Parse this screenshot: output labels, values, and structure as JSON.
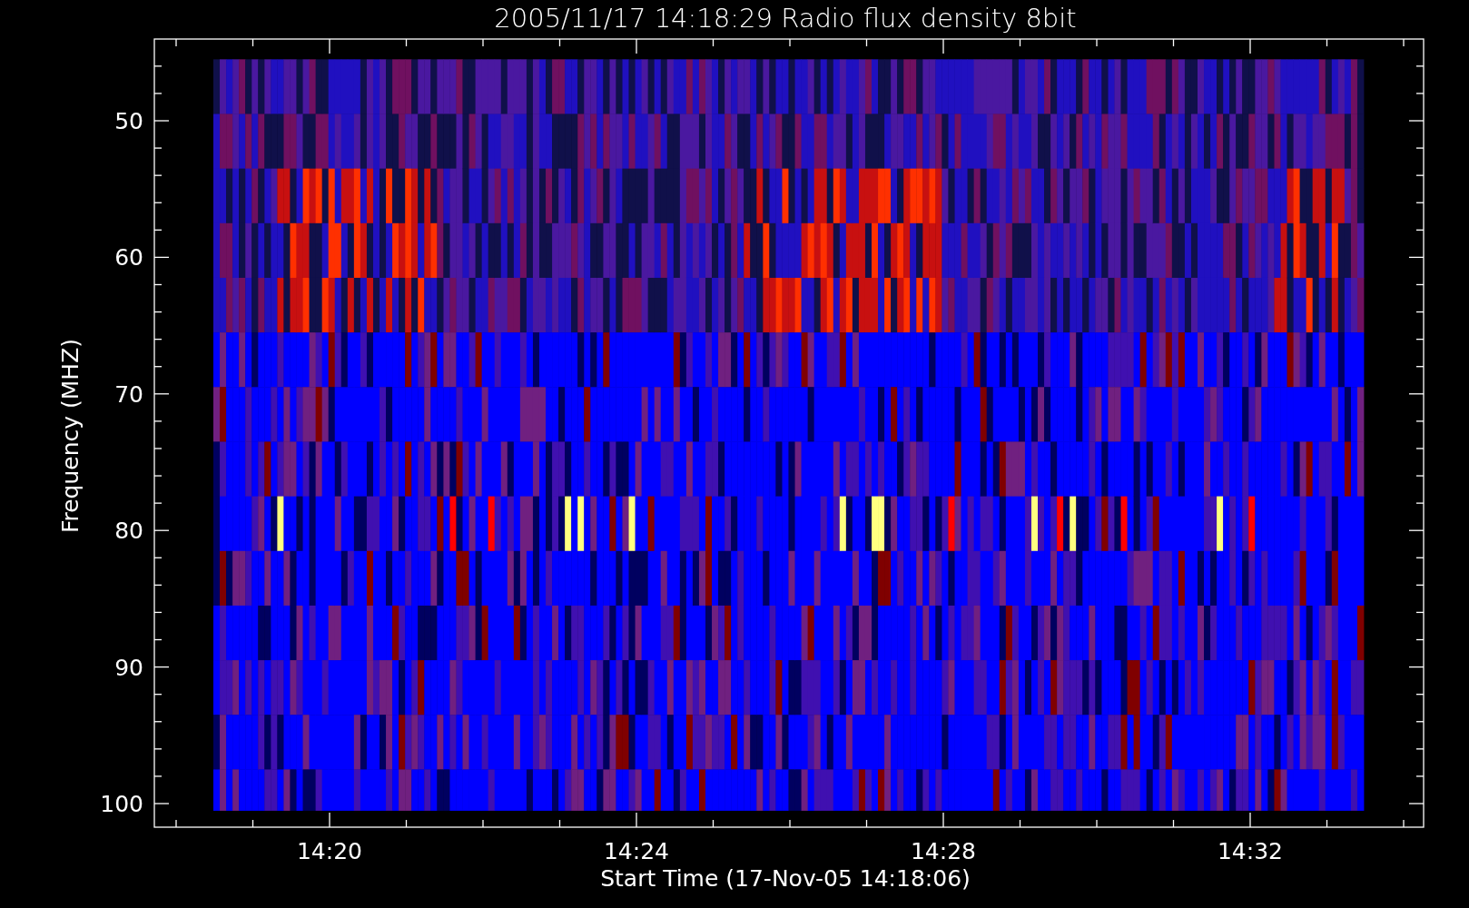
{
  "plot": {
    "title": "2005/11/17 14:18:29 Radio flux density 8bit",
    "xlabel": "Start Time (17-Nov-05 14:18:06)",
    "ylabel": "Frequency (MHZ)",
    "yticks": [
      "50",
      "60",
      "70",
      "80",
      "90",
      "100"
    ],
    "xticks": [
      "14:20",
      "14:24",
      "14:28",
      "14:32"
    ]
  }
}
